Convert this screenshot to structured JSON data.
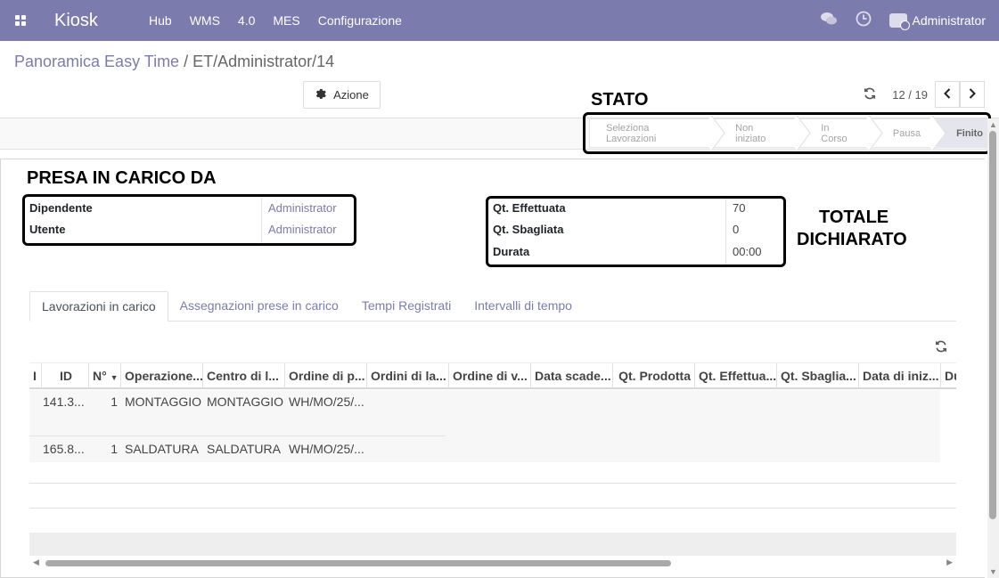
{
  "navbar": {
    "brand": "Kiosk",
    "menu": [
      "Hub",
      "WMS",
      "4.0",
      "MES",
      "Configurazione"
    ],
    "user_name": "Administrator"
  },
  "breadcrumb": {
    "parent": "Panoramica Easy Time",
    "separator": "/",
    "current": "ET/Administrator/14"
  },
  "actions": {
    "azione_label": "Azione"
  },
  "pager": {
    "value": "12 / 19"
  },
  "statusbar": {
    "stages": [
      "Seleziona Lavorazioni",
      "Non iniziato",
      "In Corso",
      "Pausa",
      "Finito"
    ],
    "active": "Finito"
  },
  "annotations": {
    "stato": "STATO",
    "presa": "PRESA IN CARICO DA",
    "totale_line1": "TOTALE",
    "totale_line2": "DICHIARATO"
  },
  "presa_fields": [
    {
      "label": "Dipendente",
      "value": "Administrator"
    },
    {
      "label": "Utente",
      "value": "Administrator"
    }
  ],
  "totals_fields": [
    {
      "label": "Qt. Effettuata",
      "value": "70"
    },
    {
      "label": "Qt. Sbagliata",
      "value": "0"
    },
    {
      "label": "Durata",
      "value": "00:00"
    }
  ],
  "tabs": [
    "Lavorazioni in carico",
    "Assegnazioni prese in carico",
    "Tempi Registrati",
    "Intervalli di tempo"
  ],
  "active_tab": "Lavorazioni in carico",
  "list": {
    "columns": [
      "I",
      "ID",
      "N°",
      "Operazione...",
      "Centro di l...",
      "Ordine di p...",
      "Ordini di la...",
      "Ordine di v...",
      "Data scade...",
      "Qt. Prodotta",
      "Qt. Effettua...",
      "Qt. Sbaglia...",
      "Data di iniz...",
      "Du"
    ],
    "rows": [
      {
        "id": "141.3...",
        "n": "1",
        "operazione": "MONTAGGIO",
        "centro": "MONTAGGIO",
        "ordine": "WH/MO/25/..."
      },
      {
        "id": "165.8...",
        "n": "1",
        "operazione": "SALDATURA",
        "centro": "SALDATURA",
        "ordine": "WH/MO/25/..."
      }
    ]
  },
  "colors": {
    "brand": "#7c7bad"
  }
}
